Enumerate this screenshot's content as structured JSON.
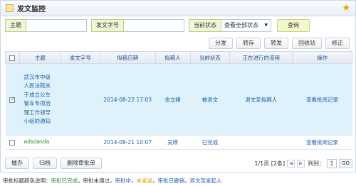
{
  "window": {
    "title": "发文监控"
  },
  "search": {
    "subject_label": "主题",
    "docno_label": "发文字号",
    "status_label": "当前状态",
    "status_value": "查看全部状态",
    "query_button": "查询"
  },
  "toolbar": [
    "分发",
    "转存",
    "转发",
    "回收站",
    "修正"
  ],
  "table": {
    "headers": [
      "主题",
      "发文字号",
      "拟稿日期",
      "拟稿人",
      "当前状态",
      "正在进行的流程",
      "操作"
    ],
    "rows": [
      {
        "checked": true,
        "subject": "武汉市中级人民法院关于成立公车管车专项治理工作领导小组的通知",
        "docno": "",
        "date": "2014-08-22 17:03",
        "drafter": "金立峰",
        "status": "被退文",
        "process": "退文至拟稿人",
        "action": "查看批阅记录"
      },
      {
        "checked": false,
        "subject": "adsdasda",
        "docno": "",
        "date": "2014-08-21 10:07",
        "drafter": "吴婷",
        "status": "已完成",
        "process": "",
        "action": "查看批阅记录"
      }
    ]
  },
  "footer": {
    "buttons": [
      "催办",
      "归档",
      "删除审批单"
    ],
    "page_info": "1/1页 [2条]",
    "goto_label": "到到：",
    "goto_value": "1",
    "go_label": "GO"
  },
  "legend": {
    "prefix": "审批标题颜色说明：",
    "done": "审批已完成",
    "nopass": "审批未通过",
    "doing": "审批中",
    "unsent": "未发送",
    "revoked": "审批已撤销",
    "back": "退文至发起人",
    "sep": "，"
  },
  "colors": {
    "accent": "#1d5fa9",
    "green": "#2b8a2b",
    "orange": "#e09600",
    "selected_row": "#dff2fb"
  }
}
